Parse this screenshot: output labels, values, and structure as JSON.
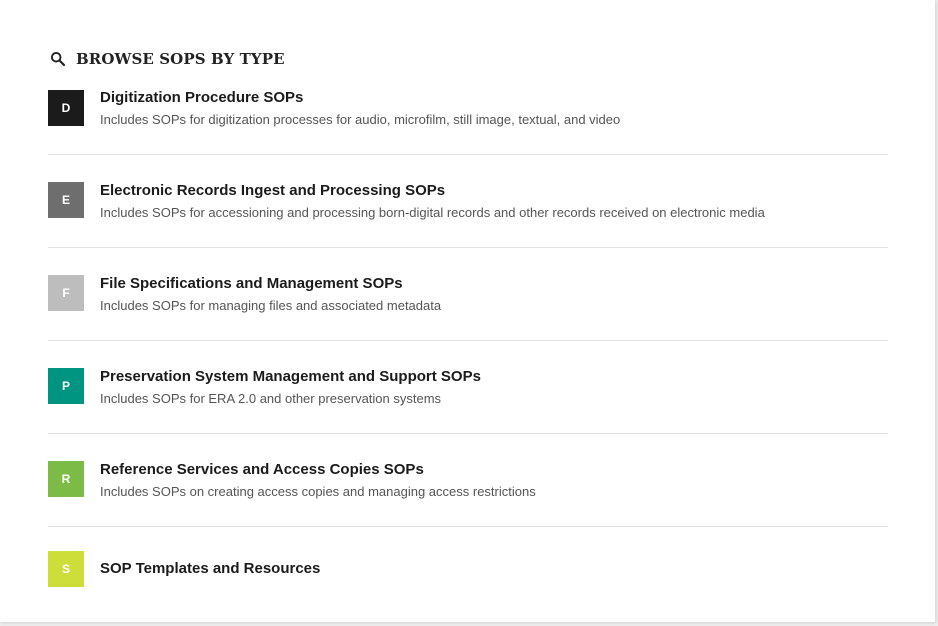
{
  "section": {
    "heading": "BROWSE SOPS BY TYPE",
    "heading_icon": "search-icon"
  },
  "categories": [
    {
      "letter": "D",
      "title": "Digitization Procedure SOPs",
      "description": "Includes SOPs for digitization processes for audio, microfilm, still image, textual, and video",
      "color": "#1b1b1b"
    },
    {
      "letter": "E",
      "title": "Electronic Records Ingest and Processing SOPs",
      "description": "Includes SOPs for accessioning and processing born-digital records and other records received on electronic media",
      "color": "#6e6e6e"
    },
    {
      "letter": "F",
      "title": "File Specifications and Management SOPs",
      "description": "Includes SOPs for managing files and associated metadata",
      "color": "#bdbdbd"
    },
    {
      "letter": "P",
      "title": "Preservation System Management and Support SOPs",
      "description": "Includes SOPs for ERA 2.0 and other preservation systems",
      "color": "#009580"
    },
    {
      "letter": "R",
      "title": "Reference Services and Access Copies SOPs",
      "description": "Includes SOPs on creating access copies and managing access restrictions",
      "color": "#7cbc46"
    },
    {
      "letter": "S",
      "title": "SOP Templates and Resources",
      "description": "",
      "color": "#cddd3a"
    }
  ]
}
